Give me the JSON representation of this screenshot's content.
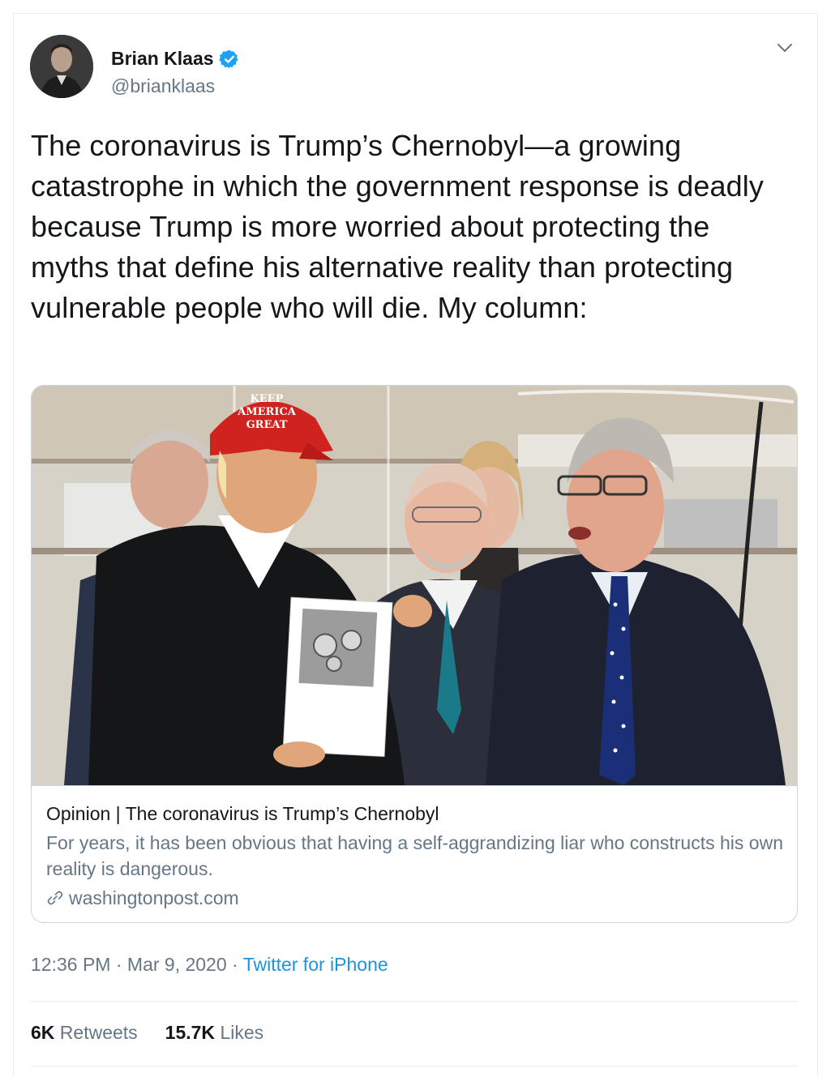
{
  "user": {
    "display_name": "Brian Klaas",
    "handle": "@brianklaas",
    "verified": true
  },
  "tweet": {
    "text": "The coronavirus is Trump’s Chernobyl—a growing catastrophe in which the government response is deadly because Trump is more worried about protecting the myths that define his alternative reality than protecting vulnerable people who will die. My column:"
  },
  "card": {
    "image_alt": "photo",
    "cap_text": [
      "KEEP",
      "AMERICA",
      "GREAT"
    ],
    "title": "Opinion | The coronavirus is Trump’s Chernobyl",
    "description": "For years, it has been obvious that having a self-aggrandizing liar who constructs his own reality is dangerous.",
    "domain": "washingtonpost.com"
  },
  "meta": {
    "time": "12:36 PM",
    "separator": " · ",
    "date": "Mar 9, 2020",
    "source": "Twitter for iPhone"
  },
  "stats": {
    "retweets_count": "6K",
    "retweets_label": "Retweets",
    "likes_count": "15.7K",
    "likes_label": "Likes"
  },
  "colors": {
    "verified_blue": "#1da1f2",
    "link_blue": "#1b95e0",
    "secondary_text": "#657786",
    "border": "#e6ecf0"
  },
  "icons": {
    "verified": "verified-badge-icon",
    "caret": "chevron-down-icon",
    "link": "link-icon"
  }
}
